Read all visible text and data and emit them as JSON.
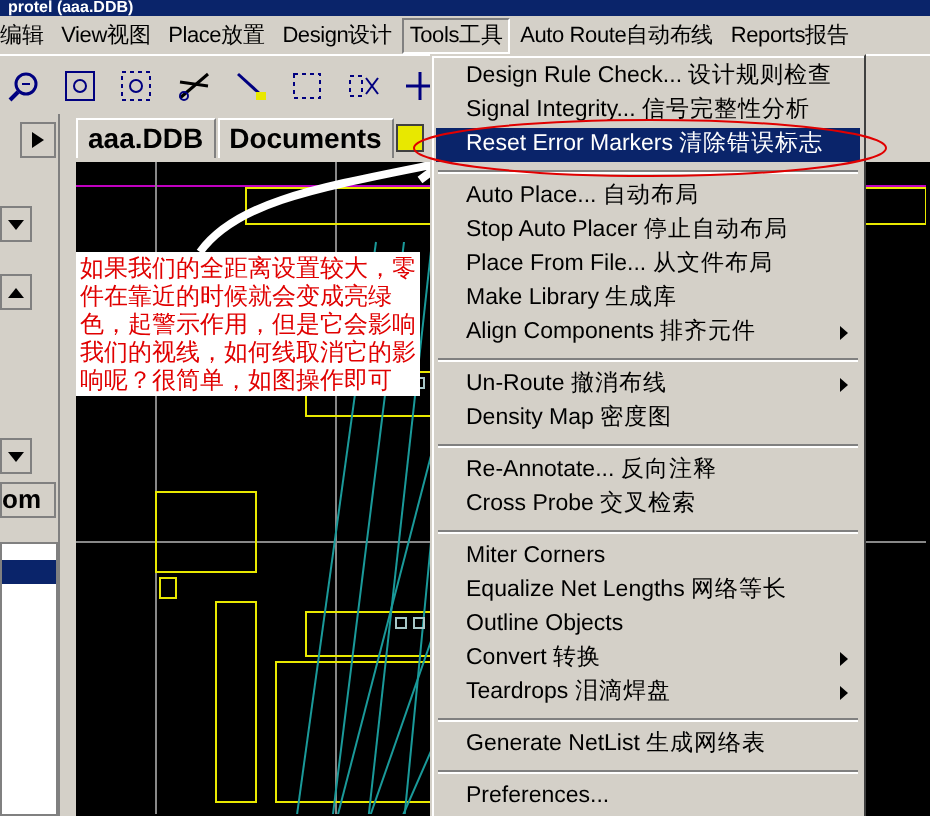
{
  "window": {
    "title": "protel (aaa.DDB)"
  },
  "menu_bar": [
    {
      "label": "编辑",
      "selected": false
    },
    {
      "label": "View视图",
      "selected": false
    },
    {
      "label": "Place放置",
      "selected": false
    },
    {
      "label": "Design设计",
      "selected": false
    },
    {
      "label": "Tools工具",
      "selected": true
    },
    {
      "label": "Auto Route自动布线",
      "selected": false
    },
    {
      "label": "Reports报告",
      "selected": false
    }
  ],
  "tabs": [
    {
      "label": "aaa.DDB",
      "selected": false
    },
    {
      "label": "Documents",
      "selected": false
    }
  ],
  "side_panel": {
    "button": "om"
  },
  "annotation": "如果我们的全距离设置较大，零件在靠近的时候就会变成亮绿色，起警示作用，但是它会影响我们的视线，如何线取消它的影响呢？很简单，如图操作即可",
  "tools_menu": [
    {
      "kind": "item",
      "label": "Design Rule Check... 设计规则检查",
      "submenu": false,
      "selected": false
    },
    {
      "kind": "item",
      "label": "Signal Integrity... 信号完整性分析",
      "submenu": false,
      "selected": false
    },
    {
      "kind": "item",
      "label": "Reset Error Markers 清除错误标志",
      "submenu": false,
      "selected": true
    },
    {
      "kind": "separator"
    },
    {
      "kind": "item",
      "label": "Auto Place... 自动布局",
      "submenu": false,
      "selected": false
    },
    {
      "kind": "item",
      "label": "Stop Auto Placer 停止自动布局",
      "submenu": false,
      "selected": false
    },
    {
      "kind": "item",
      "label": "Place From File... 从文件布局",
      "submenu": false,
      "selected": false
    },
    {
      "kind": "item",
      "label": "Make Library 生成库",
      "submenu": false,
      "selected": false
    },
    {
      "kind": "item",
      "label": "Align Components 排齐元件",
      "submenu": true,
      "selected": false
    },
    {
      "kind": "separator"
    },
    {
      "kind": "item",
      "label": "Un-Route 撤消布线",
      "submenu": true,
      "selected": false
    },
    {
      "kind": "item",
      "label": "Density Map 密度图",
      "submenu": false,
      "selected": false
    },
    {
      "kind": "separator"
    },
    {
      "kind": "item",
      "label": "Re-Annotate... 反向注释",
      "submenu": false,
      "selected": false
    },
    {
      "kind": "item",
      "label": "Cross Probe 交叉检索",
      "submenu": false,
      "selected": false
    },
    {
      "kind": "separator"
    },
    {
      "kind": "item",
      "label": "Miter Corners",
      "submenu": false,
      "selected": false
    },
    {
      "kind": "item",
      "label": "Equalize Net Lengths 网络等长",
      "submenu": false,
      "selected": false
    },
    {
      "kind": "item",
      "label": "Outline Objects",
      "submenu": false,
      "selected": false
    },
    {
      "kind": "item",
      "label": "Convert 转换",
      "submenu": true,
      "selected": false
    },
    {
      "kind": "item",
      "label": "Teardrops 泪滴焊盘",
      "submenu": true,
      "selected": false
    },
    {
      "kind": "separator"
    },
    {
      "kind": "item",
      "label": "Generate NetList 生成网络表",
      "submenu": false,
      "selected": false
    },
    {
      "kind": "separator"
    },
    {
      "kind": "item",
      "label": "Preferences...",
      "submenu": false,
      "selected": false
    }
  ]
}
